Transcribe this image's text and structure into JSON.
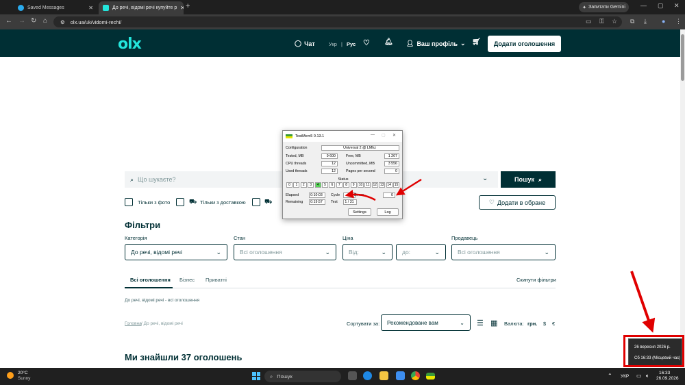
{
  "browser": {
    "tabs": [
      {
        "label": "Saved Messages",
        "icon": "telegram-icon"
      },
      {
        "label": "До речі, відомі речі купуйте р",
        "icon": "olx-icon"
      }
    ],
    "new_tab": "+",
    "gemini_label": "Запитати Gemini",
    "url": "olx.ua/uk/vidomi-rechi/"
  },
  "header": {
    "logo": "olx",
    "chat": "Чат",
    "lang_ukr": "Укр",
    "lang_sep": "|",
    "lang_rus": "Рус",
    "profile": "Ваш профіль",
    "add_listing": "Додати оголошення"
  },
  "search": {
    "placeholder": "Що шукаєте?",
    "button": "Пошук",
    "only_photo": "Тільки з фото",
    "only_delivery": "Тільки з доставкою",
    "favorites": "Додати в обране"
  },
  "filters": {
    "title": "Фільтри",
    "category_label": "Категорія",
    "category_value": "До речі, відомі речі",
    "state_label": "Стан",
    "state_value": "Всі оголошення",
    "price_label": "Ціна",
    "price_from": "Від:",
    "price_to": "до:",
    "seller_label": "Продавець",
    "seller_value": "Всі оголошення",
    "tabs": [
      "Всі оголошення",
      "Бізнес",
      "Приватні"
    ],
    "reset": "Скинути фільтри",
    "crumb": "До речі, відомі речі - всі оголошення",
    "crumb_home": "Головна",
    "crumb_tail": " / До речі, відомі речі"
  },
  "sort": {
    "label": "Сортувати за:",
    "value": "Рекомендоване вам",
    "currency_label": "Валюта:",
    "uah": "грн.",
    "usd": "$",
    "eur": "€"
  },
  "results": "Ми знайшли 37 оголошень",
  "testmem": {
    "title": "TestMem5 0.13.1",
    "configuration_label": "Configuration",
    "configuration": "Universal 2 @ LMhz",
    "tested_label": "Tested, MB",
    "tested": "9 600",
    "free_label": "Free, MB",
    "free": "1 207",
    "cpu_label": "CPU threads",
    "cpu": "12",
    "uncommitted_label": "Uncommitted, MB",
    "uncommitted": "3 556",
    "used_label": "Used threads",
    "used": "12",
    "pps_label": "Pages per second",
    "pps": "0",
    "status_label": "Status",
    "cells": [
      "0",
      "1",
      "2",
      "3",
      "4",
      "5",
      "6",
      "7",
      "8",
      "9",
      "10",
      "11",
      "12",
      "13",
      "14",
      "15"
    ],
    "active_cell": 4,
    "elapsed_label": "Elapsed",
    "elapsed": "0:10:03",
    "cycle_label": "Cycle",
    "cycle": "2",
    "errors_label": "Errors",
    "errors": "0",
    "remaining_label": "Remaining",
    "remaining": "0:19:57",
    "test_label": "Test",
    "test": "1 / 31",
    "settings_btn": "Settings",
    "log_btn": "Log"
  },
  "taskbar": {
    "temp": "20°C",
    "weather": "Sunny",
    "search": "Пошук",
    "lang": "УКР",
    "time": "16:33",
    "date": "26.09.2026"
  },
  "popup": {
    "date_long": "26 вересня 2026 р.",
    "time_long": "Сб 16:33 (Місцевий час)"
  },
  "colors": {
    "olx_dark": "#002f34",
    "olx_teal": "#23e5db",
    "annotation_red": "#e00000"
  }
}
